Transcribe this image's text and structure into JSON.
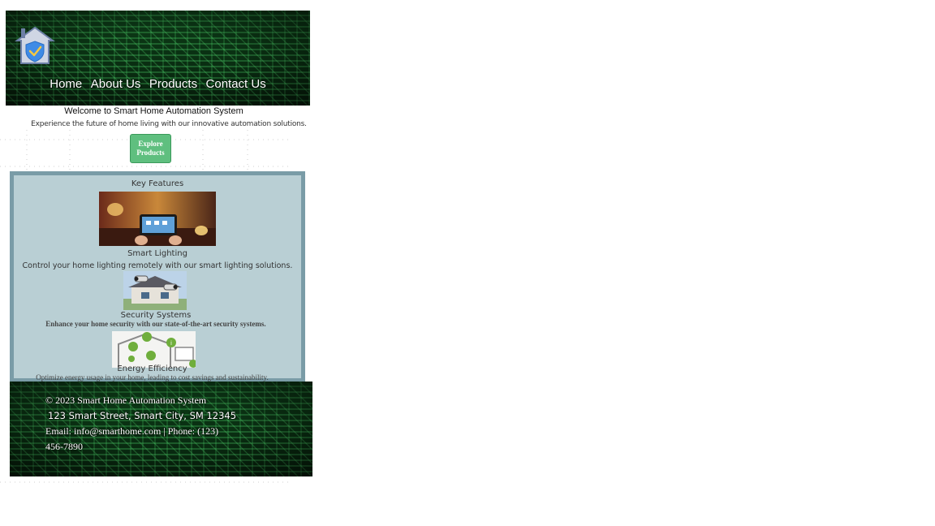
{
  "header": {
    "logo_icon": "home-shield-icon",
    "nav": [
      "Home",
      "About Us",
      "Products",
      "Contact Us"
    ]
  },
  "hero": {
    "title": "Welcome to Smart Home Automation System",
    "subtitle": "Experience the future of home living with our innovative automation solutions.",
    "cta_label": "Explore Products"
  },
  "features": {
    "title": "Key Features",
    "items": [
      {
        "name": "Smart Lighting",
        "description": "Control your home lighting remotely with our smart lighting solutions."
      },
      {
        "name": "Security Systems",
        "description": "Enhance your home security with our state-of-the-art security systems."
      },
      {
        "name": "Energy Efficiency",
        "description": "Optimize energy usage in your home, leading to cost savings and sustainability."
      }
    ]
  },
  "footer": {
    "copyright": "© 2023 Smart Home Automation System",
    "address": "123 Smart Street, Smart City, SM 12345",
    "contact_line1": "Email: info@smarthome.com | Phone: (123)",
    "contact_line2": "456-7890"
  },
  "colors": {
    "header_bg": "#0a2e12",
    "button": "#5fbf7f",
    "features_bg": "#b9cfd4",
    "features_border": "#7a9ca7"
  }
}
